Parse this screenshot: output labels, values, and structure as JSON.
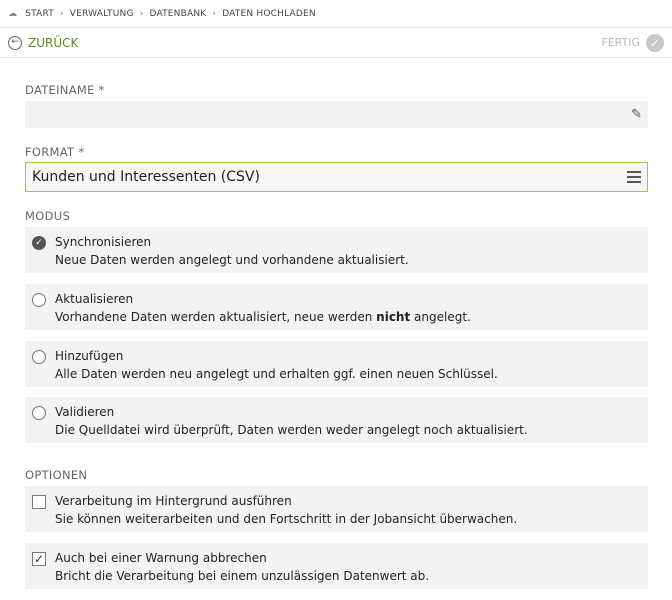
{
  "breadcrumb": {
    "items": [
      "START",
      "VERWALTUNG",
      "DATENBANK",
      "DATEN HOCHLADEN"
    ]
  },
  "toolbar": {
    "back_label": "ZURÜCK",
    "done_label": "FERTIG"
  },
  "form": {
    "filename_label": "DATEINAME *",
    "filename_value": "",
    "format_label": "FORMAT *",
    "format_value": "Kunden und Interessenten (CSV)",
    "mode_label": "MODUS",
    "options_label": "OPTIONEN"
  },
  "modes": [
    {
      "title": "Synchronisieren",
      "desc": "Neue Daten werden angelegt und vorhandene aktualisiert.",
      "selected": true
    },
    {
      "title": "Aktualisieren",
      "desc_pre": "Vorhandene Daten werden aktualisiert, neue werden ",
      "desc_bold": "nicht",
      "desc_post": " angelegt.",
      "selected": false
    },
    {
      "title": "Hinzufügen",
      "desc": "Alle Daten werden neu angelegt und erhalten ggf. einen neuen Schlüssel.",
      "selected": false
    },
    {
      "title": "Validieren",
      "desc": "Die Quelldatei wird überprüft, Daten werden weder angelegt noch aktualisiert.",
      "selected": false
    }
  ],
  "options": [
    {
      "title": "Verarbeitung im Hintergrund ausführen",
      "desc": "Sie können weiterarbeiten und den Fortschritt in der Jobansicht überwachen.",
      "checked": false
    },
    {
      "title": "Auch bei einer Warnung abbrechen",
      "desc": "Bricht die Verarbeitung bei einem unzulässigen Datenwert ab.",
      "checked": true
    }
  ],
  "colors": {
    "accent": "#5b8a1a",
    "focus_border": "#9ccc35",
    "field_bg": "#f3f3f3"
  }
}
